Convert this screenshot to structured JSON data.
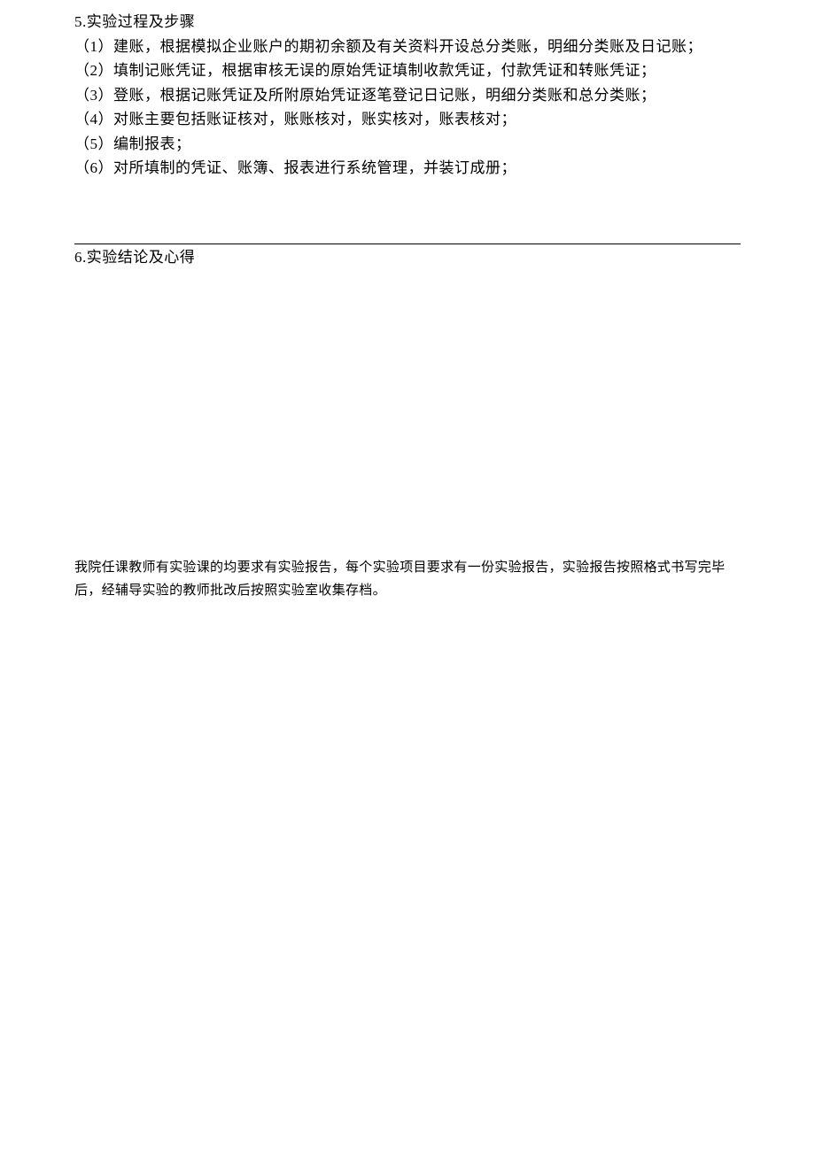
{
  "section5": {
    "header": "5.实验过程及步骤",
    "steps": [
      "（1）建账，根据模拟企业账户的期初余额及有关资料开设总分类账，明细分类账及日记账；",
      "（2）填制记账凭证，根据审核无误的原始凭证填制收款凭证，付款凭证和转账凭证；",
      "（3）登账，根据记账凭证及所附原始凭证逐笔登记日记账，明细分类账和总分类账；",
      "（4）对账主要包括账证核对，账账核对，账实核对，账表核对；",
      "（5）编制报表；",
      "（6）对所填制的凭证、账簿、报表进行系统管理，并装订成册；"
    ]
  },
  "section6": {
    "header": "6.实验结论及心得"
  },
  "footer": {
    "note": "我院任课教师有实验课的均要求有实验报告，每个实验项目要求有一份实验报告，实验报告按照格式书写完毕后，经辅导实验的教师批改后按照实验室收集存档。"
  }
}
